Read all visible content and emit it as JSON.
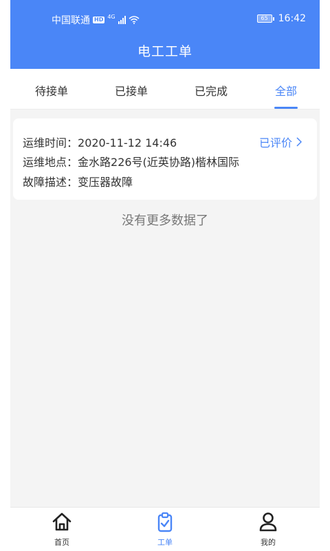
{
  "status_bar": {
    "carrier": "中国联通",
    "hd": "HD",
    "network": "4G",
    "battery": "65",
    "time": "16:42"
  },
  "header": {
    "title": "电工工单"
  },
  "tabs": [
    {
      "label": "待接单",
      "active": false
    },
    {
      "label": "已接单",
      "active": false
    },
    {
      "label": "已完成",
      "active": false
    },
    {
      "label": "全部",
      "active": true
    }
  ],
  "order": {
    "time_label": "运维时间：",
    "time_value": "2020-11-12 14:46",
    "location_label": "运维地点：",
    "location_value": "金水路226号(近英协路)楷林国际",
    "fault_label": "故障描述：",
    "fault_value": "变压器故障",
    "status_link": "已评价"
  },
  "list_footer": "没有更多数据了",
  "bottom_nav": [
    {
      "label": "首页",
      "icon": "home-icon"
    },
    {
      "label": "工单",
      "icon": "clipboard-check-icon",
      "active": true
    },
    {
      "label": "我的",
      "icon": "user-icon"
    }
  ],
  "colors": {
    "accent": "#4a86f7",
    "background": "#f4f4f4"
  }
}
